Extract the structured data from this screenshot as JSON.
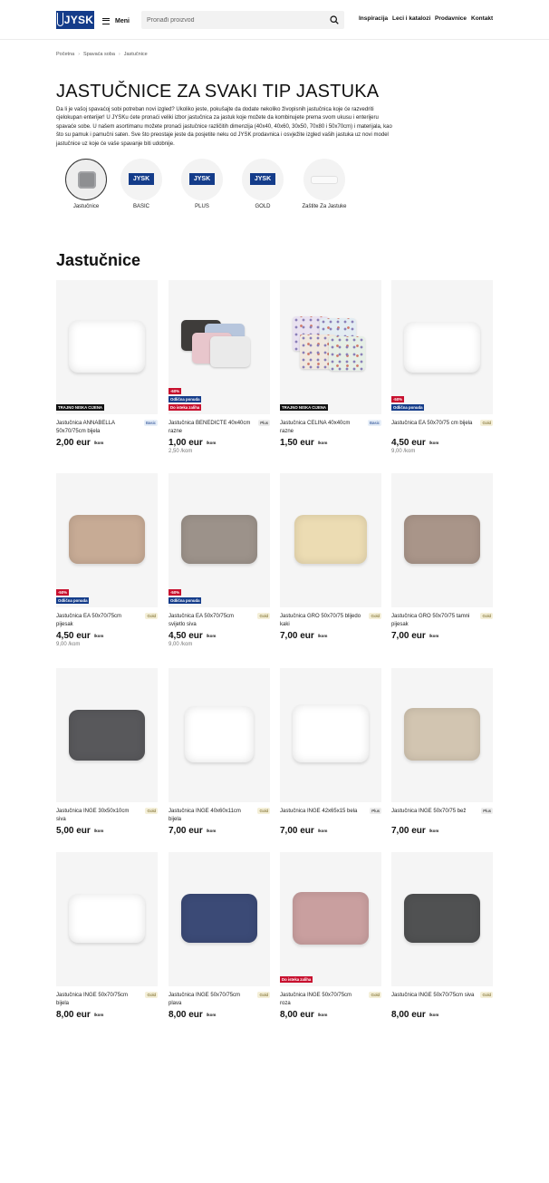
{
  "header": {
    "logo_text": "JYSK",
    "menu_label": "Meni",
    "search_placeholder": "Pronađi proizvod",
    "nav": [
      "Inspiracija",
      "Leci i katalozi",
      "Prodavnice",
      "Kontakt"
    ]
  },
  "breadcrumb": [
    "Početna",
    "Spavaća soba",
    "Jastučnice"
  ],
  "page": {
    "title": "JASTUČNICE ZA SVAKI TIP JASTUKA",
    "intro": "Da li je vašoj spavaćoj sobi potreban novi izgled? Ukoliko jeste, pokušajte da dodate nekoliko živopisnih jastučnica koje će razvedriti cjelokupan enterijer! U JYSKu ćete pronaći veliki izbor jastučnica za jastuk koje možete da kombinujete prema svom ukusu i enterijeru spavaće sobe. U našem asortimanu možete pronaći jastučnice različitih dimenzija (40x40, 40x60, 30x50, 70x80 i 50x70cm) i materijala, kao što su pamuk i pamučni saten. Sve što preostaje jeste da posjetite neku od JYSK prodavnica i osvježite izgled vaših jastuka uz novi model jastučnice uz koje će vaše spavanje biti udobnije."
  },
  "categories": [
    {
      "label": "Jastučnice",
      "icon": "pillow-icon"
    },
    {
      "label": "BASIC",
      "icon": "jysk-logo-icon"
    },
    {
      "label": "PLUS",
      "icon": "jysk-logo-icon"
    },
    {
      "label": "GOLD",
      "icon": "jysk-logo-icon"
    },
    {
      "label": "Zaštite Za Jastuke",
      "icon": "pillow-protector-icon"
    }
  ],
  "section_title": "Jastučnice",
  "unit": "/kom",
  "products": [
    {
      "name": "Jastučnica ANNABELLA 50x70/75cm bijela",
      "tier": "Basic",
      "price": "2,00 eur",
      "old": "",
      "badges": [
        "TRAJNO NISKA CIJENA"
      ],
      "color": "#ffffff"
    },
    {
      "name": "Jastučnica BENEDICTE 40x40cm razne",
      "tier": "Plus",
      "price": "1,00 eur",
      "old": "2,50 /kom",
      "badges": [
        "-60%",
        "Odlična ponuda",
        "Do isteka zaliha"
      ],
      "color": "#e7c9cf"
    },
    {
      "name": "Jastučnica CELINA 40x40cm razne",
      "tier": "Basic",
      "price": "1,50 eur",
      "old": "",
      "badges": [
        "TRAJNO NISKA CIJENA"
      ],
      "color": "#ffffff"
    },
    {
      "name": "Jastučnica EA 50x70/75 cm bijela",
      "tier": "Gold",
      "price": "4,50 eur",
      "old": "9,00 /kom",
      "badges": [
        "-50%",
        "Odlična ponuda"
      ],
      "color": "#ffffff"
    },
    {
      "name": "Jastučnica EA 50x70/75cm pijesak",
      "tier": "Gold",
      "price": "4,50 eur",
      "old": "9,00 /kom",
      "badges": [
        "-50%",
        "Odlična ponuda"
      ],
      "color": "#c7ab95"
    },
    {
      "name": "Jastučnica EA 50x70/75cm svijetlo siva",
      "tier": "Gold",
      "price": "4,50 eur",
      "old": "9,00 /kom",
      "badges": [
        "-50%",
        "Odlična ponuda"
      ],
      "color": "#9c928a"
    },
    {
      "name": "Jastučnica GRO 50x70/75 blijedo kaki",
      "tier": "Gold",
      "price": "7,00 eur",
      "old": "",
      "badges": [],
      "color": "#ecdcb3"
    },
    {
      "name": "Jastučnica GRO 50x70/75 tamni pijesak",
      "tier": "Gold",
      "price": "7,00 eur",
      "old": "",
      "badges": [],
      "color": "#a99589"
    },
    {
      "name": "Jastučnica INGE 30x50x10cm siva",
      "tier": "Gold",
      "price": "5,00 eur",
      "old": "",
      "badges": [],
      "color": "#58585b"
    },
    {
      "name": "Jastučnica INGE 40x60x11cm bijela",
      "tier": "Gold",
      "price": "7,00 eur",
      "old": "",
      "badges": [],
      "color": "#ffffff"
    },
    {
      "name": "Jastučnica INGE 42x65x15 bela",
      "tier": "Plus",
      "price": "7,00 eur",
      "old": "",
      "badges": [],
      "color": "#ffffff"
    },
    {
      "name": "Jastučnica INGE 50x70/75 bež",
      "tier": "Plus",
      "price": "7,00 eur",
      "old": "",
      "badges": [],
      "color": "#d2c5b1"
    },
    {
      "name": "Jastučnica INGE 50x70/75cm bijela",
      "tier": "Gold",
      "price": "8,00 eur",
      "old": "",
      "badges": [],
      "color": "#ffffff"
    },
    {
      "name": "Jastučnica INGE 50x70/75cm plava",
      "tier": "Gold",
      "price": "8,00 eur",
      "old": "",
      "badges": [],
      "color": "#3b4a76"
    },
    {
      "name": "Jastučnica INGE 50x70/75cm roza",
      "tier": "Gold",
      "price": "8,00 eur",
      "old": "",
      "badges": [
        "Do isteka zaliha"
      ],
      "color": "#c99f9f"
    },
    {
      "name": "Jastučnica INGE 50x70/75cm siva",
      "tier": "Gold",
      "price": "8,00 eur",
      "old": "",
      "badges": [],
      "color": "#505152"
    }
  ]
}
